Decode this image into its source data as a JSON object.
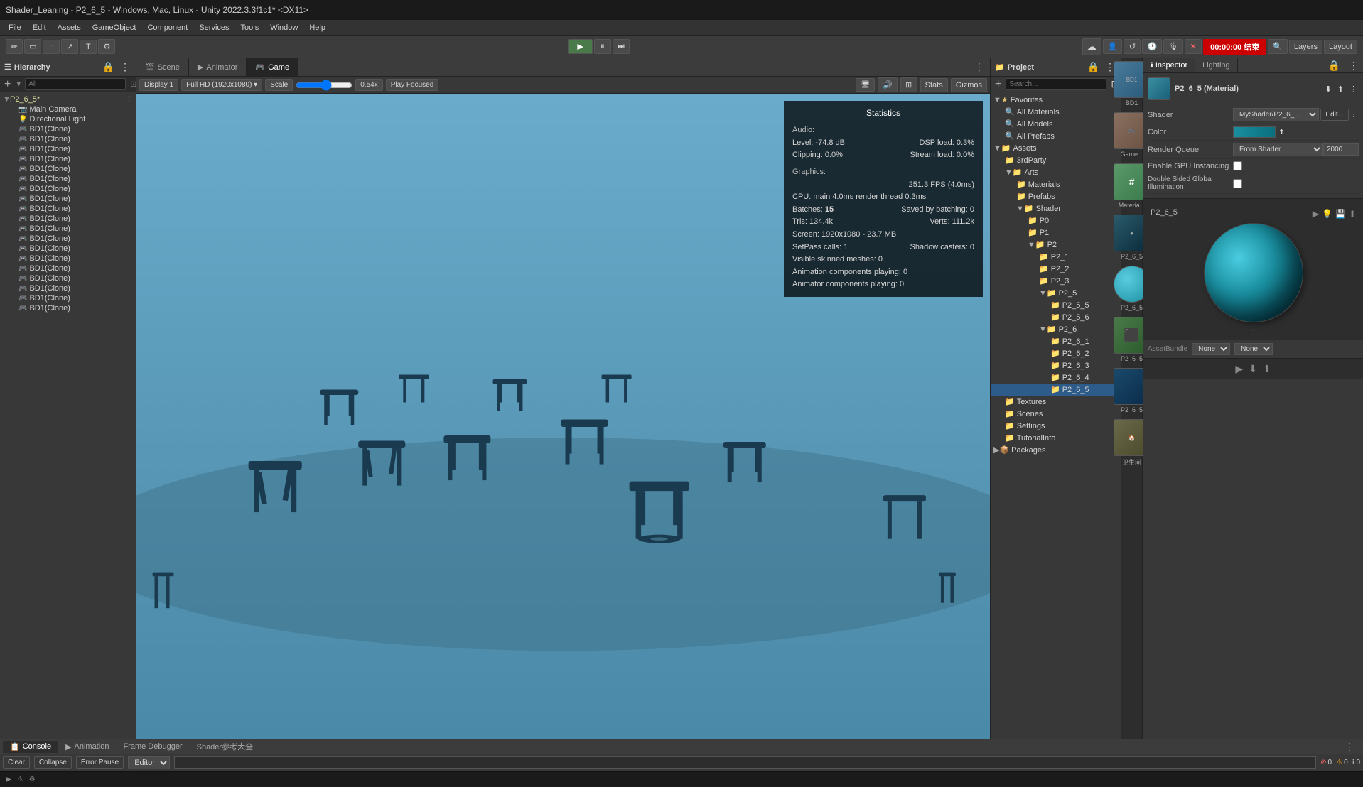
{
  "title_bar": {
    "text": "Shader_Leaning - P2_6_5 - Windows, Mac, Linux - Unity 2022.3.3f1c1* <DX11>"
  },
  "menu": {
    "items": [
      "File",
      "Edit",
      "Assets",
      "GameObject",
      "Component",
      "Services",
      "Tools",
      "Window",
      "Help"
    ]
  },
  "toolbar": {
    "tools": [
      "✏",
      "▭",
      "○",
      "↗",
      "T",
      "⚙"
    ],
    "play_btn": "▶",
    "pause_btn": "⏸",
    "step_btn": "⏭",
    "timer": "00:00:00 结束",
    "collab_btn": "↺",
    "search_btn": "🔍",
    "layers_label": "Layers",
    "layout_label": "Layout",
    "account_btn": "👤",
    "cloud_btn": "☁",
    "settings_btn": "⚙"
  },
  "hierarchy": {
    "title": "Hierarchy",
    "search_placeholder": "All",
    "items": [
      {
        "label": "P2_6_5*",
        "level": 0,
        "has_children": true,
        "selected": false
      },
      {
        "label": "Main Camera",
        "level": 1,
        "has_children": false,
        "icon": "📷"
      },
      {
        "label": "Directional Light",
        "level": 1,
        "has_children": false,
        "icon": "💡"
      },
      {
        "label": "BD1(Clone)",
        "level": 1,
        "has_children": false,
        "icon": "🎮"
      },
      {
        "label": "BD1(Clone)",
        "level": 1,
        "has_children": false,
        "icon": "🎮"
      },
      {
        "label": "BD1(Clone)",
        "level": 1,
        "has_children": false,
        "icon": "🎮"
      },
      {
        "label": "BD1(Clone)",
        "level": 1,
        "has_children": false,
        "icon": "🎮"
      },
      {
        "label": "BD1(Clone)",
        "level": 1,
        "has_children": false,
        "icon": "🎮"
      },
      {
        "label": "BD1(Clone)",
        "level": 1,
        "has_children": false,
        "icon": "🎮"
      },
      {
        "label": "BD1(Clone)",
        "level": 1,
        "has_children": false,
        "icon": "🎮"
      },
      {
        "label": "BD1(Clone)",
        "level": 1,
        "has_children": false,
        "icon": "🎮"
      },
      {
        "label": "BD1(Clone)",
        "level": 1,
        "has_children": false,
        "icon": "🎮"
      },
      {
        "label": "BD1(Clone)",
        "level": 1,
        "has_children": false,
        "icon": "🎮"
      },
      {
        "label": "BD1(Clone)",
        "level": 1,
        "has_children": false,
        "icon": "🎮"
      },
      {
        "label": "BD1(Clone)",
        "level": 1,
        "has_children": false,
        "icon": "🎮"
      },
      {
        "label": "BD1(Clone)",
        "level": 1,
        "has_children": false,
        "icon": "🎮"
      },
      {
        "label": "BD1(Clone)",
        "level": 1,
        "has_children": false,
        "icon": "🎮"
      },
      {
        "label": "BD1(Clone)",
        "level": 1,
        "has_children": false,
        "icon": "🎮"
      },
      {
        "label": "BD1(Clone)",
        "level": 1,
        "has_children": false,
        "icon": "🎮"
      },
      {
        "label": "BD1(Clone)",
        "level": 1,
        "has_children": false,
        "icon": "🎮"
      },
      {
        "label": "BD1(Clone)",
        "level": 1,
        "has_children": false,
        "icon": "🎮"
      },
      {
        "label": "BD1(Clone)",
        "level": 1,
        "has_children": false,
        "icon": "🎮"
      }
    ]
  },
  "scene_view": {
    "tabs": [
      {
        "label": "Scene",
        "icon": "🎬",
        "active": false
      },
      {
        "label": "Animator",
        "icon": "▶",
        "active": false
      },
      {
        "label": "Game",
        "icon": "🎮",
        "active": true
      }
    ],
    "toolbar": {
      "display": "Display 1",
      "resolution": "Full HD (1920x1080)",
      "scale_label": "Scale",
      "scale_value": "0.54x",
      "play_focused": "Play Focused",
      "stats": "Stats",
      "gizmos": "Gizmos"
    }
  },
  "statistics": {
    "title": "Statistics",
    "audio": {
      "label": "Audio:",
      "level_label": "Level:",
      "level_value": "-74.8 dB",
      "dsp_load_label": "DSP load:",
      "dsp_load_value": "0.3%",
      "clipping_label": "Clipping:",
      "clipping_value": "0.0%",
      "stream_load_label": "Stream load:",
      "stream_load_value": "0.0%"
    },
    "graphics": {
      "label": "Graphics:",
      "fps_value": "251.3 FPS (4.0ms)",
      "cpu_label": "CPU:",
      "cpu_value": "main 4.0ms  render thread 0.3ms",
      "batches_label": "Batches:",
      "batches_value": "15",
      "saved_batching_label": "Saved by batching:",
      "saved_batching_value": "0",
      "tris_label": "Tris:",
      "tris_value": "134.4k",
      "verts_label": "Verts:",
      "verts_value": "111.2k",
      "screen_label": "Screen:",
      "screen_value": "1920x1080 - 23.7 MB",
      "setpass_label": "SetPass calls:",
      "setpass_value": "1",
      "shadow_casters_label": "Shadow casters:",
      "shadow_casters_value": "0",
      "visible_skinned_label": "Visible skinned meshes:",
      "visible_skinned_value": "0",
      "anim_components_label": "Animation components playing:",
      "anim_components_value": "0",
      "animator_label": "Animator components playing:",
      "animator_value": "0"
    }
  },
  "project_panel": {
    "title": "Project",
    "favorites": {
      "label": "Favorites",
      "items": [
        "All Materials",
        "All Models",
        "All Prefabs"
      ]
    },
    "assets": {
      "label": "Assets",
      "items": [
        {
          "label": "3rdParty",
          "level": 1
        },
        {
          "label": "Arts",
          "level": 1,
          "children": [
            {
              "label": "Materials",
              "level": 2
            },
            {
              "label": "Prefabs",
              "level": 2
            },
            {
              "label": "Shader",
              "level": 2,
              "children": [
                {
                  "label": "P0",
                  "level": 3
                },
                {
                  "label": "P1",
                  "level": 3
                },
                {
                  "label": "P2",
                  "level": 3,
                  "children": [
                    {
                      "label": "P2_1",
                      "level": 4
                    },
                    {
                      "label": "P2_2",
                      "level": 4
                    },
                    {
                      "label": "P2_3",
                      "level": 4
                    },
                    {
                      "label": "P2_5",
                      "level": 4,
                      "children": [
                        {
                          "label": "P2_5_5",
                          "level": 5
                        },
                        {
                          "label": "P2_5_6",
                          "level": 5
                        }
                      ]
                    },
                    {
                      "label": "P2_6",
                      "level": 4,
                      "children": [
                        {
                          "label": "P2_6_1",
                          "level": 5
                        },
                        {
                          "label": "P2_6_2",
                          "level": 5
                        },
                        {
                          "label": "P2_6_3",
                          "level": 5
                        },
                        {
                          "label": "P2_6_4",
                          "level": 5
                        },
                        {
                          "label": "P2_6_5",
                          "level": 5,
                          "selected": true
                        }
                      ]
                    }
                  ]
                }
              ]
            }
          ]
        },
        {
          "label": "Textures",
          "level": 1
        },
        {
          "label": "Scenes",
          "level": 1
        },
        {
          "label": "Settings",
          "level": 1
        },
        {
          "label": "TutorialInfo",
          "level": 1
        }
      ]
    },
    "packages": {
      "label": "Packages"
    }
  },
  "inspector": {
    "tabs": [
      {
        "label": "Inspector",
        "active": true
      },
      {
        "label": "Lighting",
        "active": false
      }
    ],
    "material": {
      "name": "P2_6_5 (Material)",
      "shader_label": "Shader",
      "shader_value": "MyShader/P2_6_...",
      "edit_btn": "Edit...",
      "color_label": "Color",
      "render_queue_label": "Render Queue",
      "render_queue_source": "From Shader",
      "render_queue_value": "2000",
      "gpu_instancing_label": "Enable GPU Instancing",
      "double_sided_label": "Double Sided Global Illumination"
    },
    "thumbnails": [
      {
        "label": "BD1",
        "color": "#6a8fa0"
      },
      {
        "label": "Game...",
        "color": "#8a7050"
      },
      {
        "label": "Materia...",
        "color": "#5a9a5a"
      },
      {
        "label": "P2_6_5",
        "color": "#2a4a5a"
      },
      {
        "label": "P2_6_5",
        "color": "#4a9aaa"
      },
      {
        "label": "P2_6_5",
        "color": "#2a7a4a"
      },
      {
        "label": "P2_6_5",
        "color": "#1a4a6a"
      },
      {
        "label": "卫生间",
        "color": "#6a6a4a"
      }
    ],
    "preview": {
      "label": "P2_6_5",
      "sphere_gradient_start": "#4acce0",
      "sphere_gradient_end": "#0a3a50"
    },
    "asset_bundle": {
      "label": "AssetBundle",
      "value1": "None",
      "value2": "None"
    }
  },
  "bottom": {
    "tabs": [
      {
        "label": "Console",
        "icon": "📋",
        "active": true
      },
      {
        "label": "Animation",
        "icon": "▶",
        "active": false
      },
      {
        "label": "Frame Debugger",
        "active": false
      },
      {
        "label": "Shader参考大全",
        "active": false
      }
    ],
    "console": {
      "clear_btn": "Clear",
      "collapse_btn": "Collapse",
      "error_pause_btn": "Error Pause",
      "editor_btn": "Editor",
      "search_placeholder": "",
      "count_errors": "0",
      "count_warnings": "0",
      "count_messages": "0"
    }
  },
  "status_bar": {
    "icons": [
      "▶",
      "⚠",
      "⚙"
    ]
  }
}
